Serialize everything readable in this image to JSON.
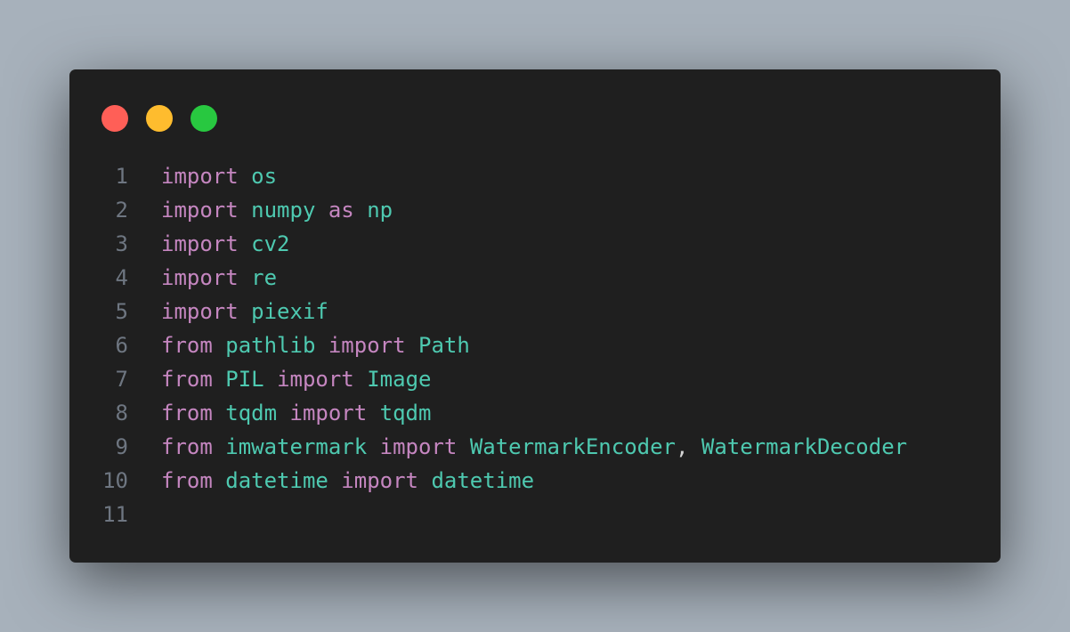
{
  "window": {
    "controls": [
      {
        "name": "close",
        "color": "#ff5f57"
      },
      {
        "name": "minimize",
        "color": "#febc2e"
      },
      {
        "name": "maximize",
        "color": "#28c840"
      }
    ]
  },
  "code": {
    "language": "python",
    "lines": [
      {
        "number": "1",
        "tokens": [
          {
            "t": "import",
            "k": "kw"
          },
          {
            "t": " ",
            "k": "pn"
          },
          {
            "t": "os",
            "k": "id"
          }
        ]
      },
      {
        "number": "2",
        "tokens": [
          {
            "t": "import",
            "k": "kw"
          },
          {
            "t": " ",
            "k": "pn"
          },
          {
            "t": "numpy",
            "k": "id"
          },
          {
            "t": " ",
            "k": "pn"
          },
          {
            "t": "as",
            "k": "kw"
          },
          {
            "t": " ",
            "k": "pn"
          },
          {
            "t": "np",
            "k": "id"
          }
        ]
      },
      {
        "number": "3",
        "tokens": [
          {
            "t": "import",
            "k": "kw"
          },
          {
            "t": " ",
            "k": "pn"
          },
          {
            "t": "cv2",
            "k": "id"
          }
        ]
      },
      {
        "number": "4",
        "tokens": [
          {
            "t": "import",
            "k": "kw"
          },
          {
            "t": " ",
            "k": "pn"
          },
          {
            "t": "re",
            "k": "id"
          }
        ]
      },
      {
        "number": "5",
        "tokens": [
          {
            "t": "import",
            "k": "kw"
          },
          {
            "t": " ",
            "k": "pn"
          },
          {
            "t": "piexif",
            "k": "id"
          }
        ]
      },
      {
        "number": "6",
        "tokens": [
          {
            "t": "from",
            "k": "kw"
          },
          {
            "t": " ",
            "k": "pn"
          },
          {
            "t": "pathlib",
            "k": "id"
          },
          {
            "t": " ",
            "k": "pn"
          },
          {
            "t": "import",
            "k": "kw"
          },
          {
            "t": " ",
            "k": "pn"
          },
          {
            "t": "Path",
            "k": "id"
          }
        ]
      },
      {
        "number": "7",
        "tokens": [
          {
            "t": "from",
            "k": "kw"
          },
          {
            "t": " ",
            "k": "pn"
          },
          {
            "t": "PIL",
            "k": "id"
          },
          {
            "t": " ",
            "k": "pn"
          },
          {
            "t": "import",
            "k": "kw"
          },
          {
            "t": " ",
            "k": "pn"
          },
          {
            "t": "Image",
            "k": "id"
          }
        ]
      },
      {
        "number": "8",
        "tokens": [
          {
            "t": "from",
            "k": "kw"
          },
          {
            "t": " ",
            "k": "pn"
          },
          {
            "t": "tqdm",
            "k": "id"
          },
          {
            "t": " ",
            "k": "pn"
          },
          {
            "t": "import",
            "k": "kw"
          },
          {
            "t": " ",
            "k": "pn"
          },
          {
            "t": "tqdm",
            "k": "id"
          }
        ]
      },
      {
        "number": "9",
        "tokens": [
          {
            "t": "from",
            "k": "kw"
          },
          {
            "t": " ",
            "k": "pn"
          },
          {
            "t": "imwatermark",
            "k": "id"
          },
          {
            "t": " ",
            "k": "pn"
          },
          {
            "t": "import",
            "k": "kw"
          },
          {
            "t": " ",
            "k": "pn"
          },
          {
            "t": "WatermarkEncoder",
            "k": "id"
          },
          {
            "t": ", ",
            "k": "pn"
          },
          {
            "t": "WatermarkDecoder",
            "k": "id"
          }
        ]
      },
      {
        "number": "10",
        "tokens": [
          {
            "t": "from",
            "k": "kw"
          },
          {
            "t": " ",
            "k": "pn"
          },
          {
            "t": "datetime",
            "k": "id"
          },
          {
            "t": " ",
            "k": "pn"
          },
          {
            "t": "import",
            "k": "kw"
          },
          {
            "t": " ",
            "k": "pn"
          },
          {
            "t": "datetime",
            "k": "id"
          }
        ]
      },
      {
        "number": "11",
        "tokens": []
      }
    ]
  }
}
